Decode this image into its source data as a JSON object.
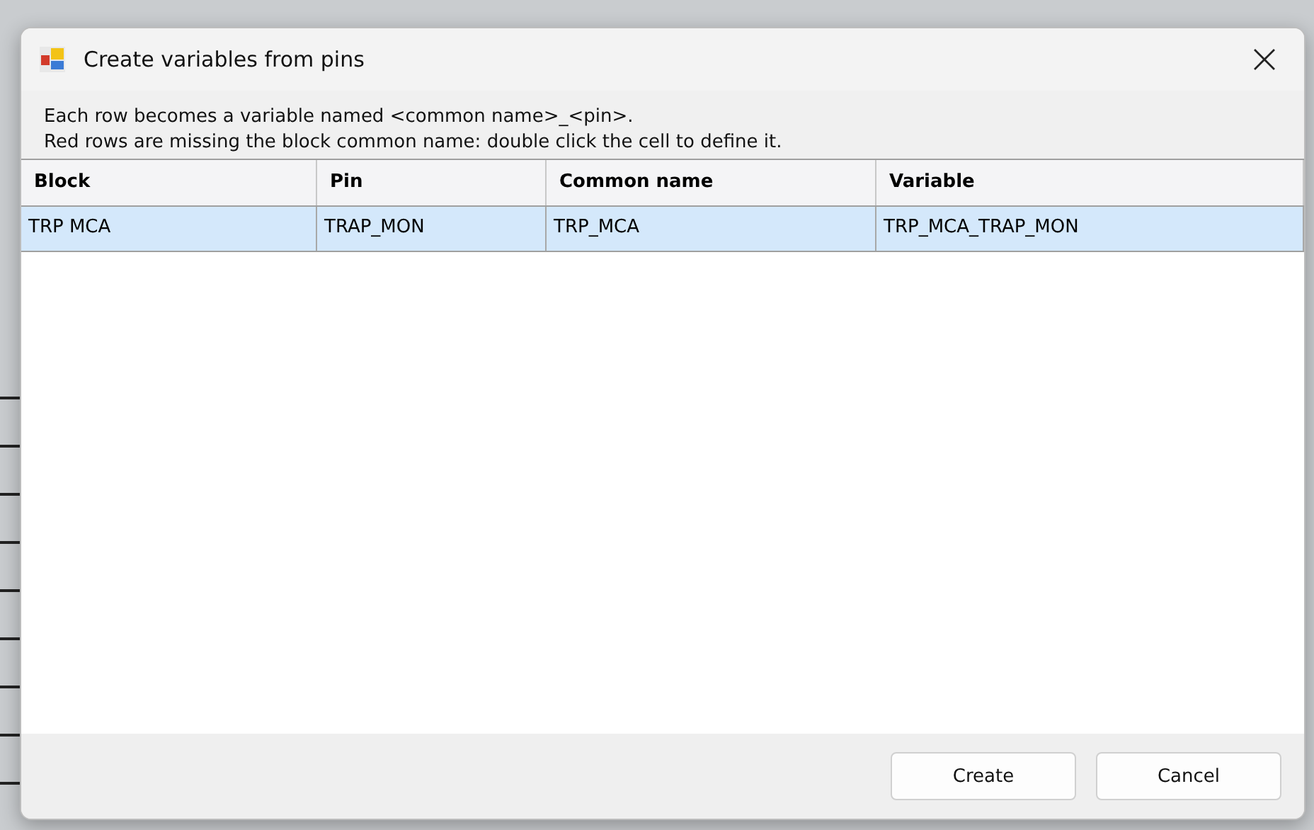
{
  "window": {
    "title": "Create variables from pins"
  },
  "message": [
    "Each row becomes a variable named <common name>_<pin>.",
    "Red rows are missing the block common name: double click the cell to define it."
  ],
  "table": {
    "columns": [
      "Block",
      "Pin",
      "Common name",
      "Variable"
    ],
    "rows": [
      {
        "cells": [
          "TRP MCA",
          "TRAP_MON",
          "TRP_MCA",
          "TRP_MCA_TRAP_MON"
        ],
        "selected": true
      }
    ]
  },
  "buttons": [
    "Create",
    "Cancel"
  ]
}
